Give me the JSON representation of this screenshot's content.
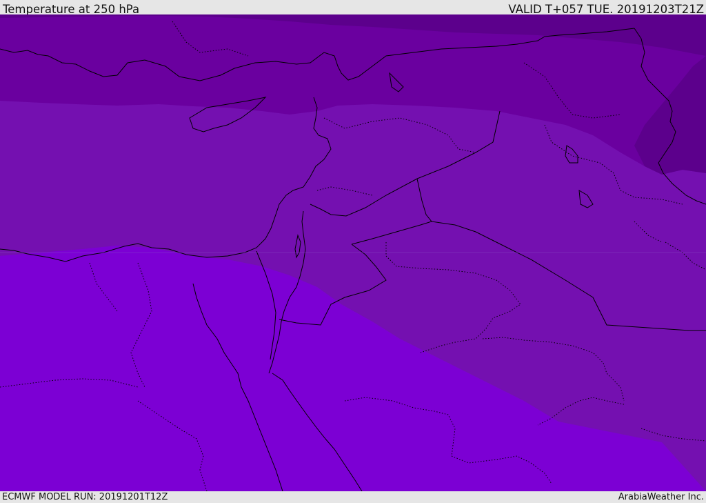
{
  "header": {
    "title": "Temperature at 250 hPa",
    "valid_time": "VALID T+057 TUE. 20191203T21Z"
  },
  "footer": {
    "model_run": "ECMWF MODEL RUN: 20191201T12Z",
    "credit": "ArabiaWeather Inc."
  },
  "map": {
    "field": "temperature",
    "level_hpa": 250,
    "band_colors": [
      "#5c008c",
      "#6a009f",
      "#7410b0",
      "#7c00d4"
    ],
    "coastline_color": "#000000",
    "border_style": "dotted"
  }
}
